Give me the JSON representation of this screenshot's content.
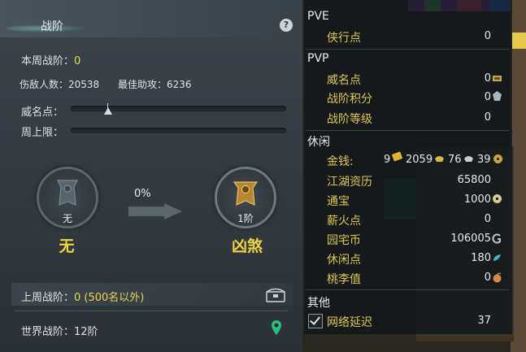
{
  "left": {
    "title": "战阶",
    "help_label": "?",
    "weekly_label": "本周战阶：",
    "weekly_value": "0",
    "kills_label": "伤敌人数：",
    "kills_value": "20538",
    "assist_label": "最佳助攻：",
    "assist_value": "6236",
    "fame_label": "威名点：",
    "weekly_cap_label": "周上限：",
    "progress_percent": "0%",
    "current_rank": {
      "badge_text": "无",
      "name": "无"
    },
    "next_rank": {
      "badge_text": "1阶",
      "name": "凶煞"
    },
    "last_week_label": "上周战阶：",
    "last_week_value": "0 (500名以外)",
    "world_label": "世界战阶：",
    "world_value": "12阶"
  },
  "right": {
    "pve": {
      "title": "PVE",
      "items": [
        {
          "label": "侠行点",
          "value": "0"
        }
      ]
    },
    "pvp": {
      "title": "PVP",
      "items": [
        {
          "label": "威名点",
          "value": "0"
        },
        {
          "label": "战阶积分",
          "value": "0"
        },
        {
          "label": "战阶等级",
          "value": "0"
        }
      ]
    },
    "leisure": {
      "title": "休闲",
      "gold_label": "金钱:",
      "gold_values": [
        "9",
        "2059",
        "76",
        "39"
      ],
      "items": [
        {
          "label": "江湖资历",
          "value": "65800"
        },
        {
          "label": "通宝",
          "value": "1000"
        },
        {
          "label": "薪火点",
          "value": "0"
        },
        {
          "label": "园宅币",
          "value": "106005"
        },
        {
          "label": "休闲点",
          "value": "180"
        },
        {
          "label": "桃李值",
          "value": "0"
        }
      ]
    },
    "other": {
      "title": "其他",
      "latency_label": "网络延迟",
      "latency_value": "37",
      "latency_checked": true
    }
  },
  "colors": {
    "accent_yellow": "#e7d94e",
    "gold_text": "#dcc94a",
    "panel_bg": "#363d44"
  }
}
